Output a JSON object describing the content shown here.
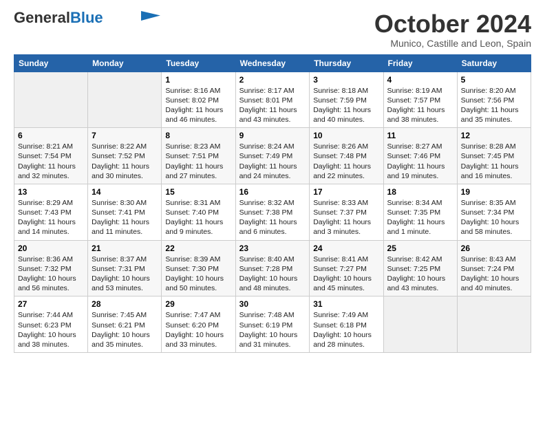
{
  "header": {
    "logo_general": "General",
    "logo_blue": "Blue",
    "month": "October 2024",
    "location": "Munico, Castille and Leon, Spain"
  },
  "days_of_week": [
    "Sunday",
    "Monday",
    "Tuesday",
    "Wednesday",
    "Thursday",
    "Friday",
    "Saturday"
  ],
  "weeks": [
    [
      {
        "day": "",
        "info": ""
      },
      {
        "day": "",
        "info": ""
      },
      {
        "day": "1",
        "info": "Sunrise: 8:16 AM\nSunset: 8:02 PM\nDaylight: 11 hours and 46 minutes."
      },
      {
        "day": "2",
        "info": "Sunrise: 8:17 AM\nSunset: 8:01 PM\nDaylight: 11 hours and 43 minutes."
      },
      {
        "day": "3",
        "info": "Sunrise: 8:18 AM\nSunset: 7:59 PM\nDaylight: 11 hours and 40 minutes."
      },
      {
        "day": "4",
        "info": "Sunrise: 8:19 AM\nSunset: 7:57 PM\nDaylight: 11 hours and 38 minutes."
      },
      {
        "day": "5",
        "info": "Sunrise: 8:20 AM\nSunset: 7:56 PM\nDaylight: 11 hours and 35 minutes."
      }
    ],
    [
      {
        "day": "6",
        "info": "Sunrise: 8:21 AM\nSunset: 7:54 PM\nDaylight: 11 hours and 32 minutes."
      },
      {
        "day": "7",
        "info": "Sunrise: 8:22 AM\nSunset: 7:52 PM\nDaylight: 11 hours and 30 minutes."
      },
      {
        "day": "8",
        "info": "Sunrise: 8:23 AM\nSunset: 7:51 PM\nDaylight: 11 hours and 27 minutes."
      },
      {
        "day": "9",
        "info": "Sunrise: 8:24 AM\nSunset: 7:49 PM\nDaylight: 11 hours and 24 minutes."
      },
      {
        "day": "10",
        "info": "Sunrise: 8:26 AM\nSunset: 7:48 PM\nDaylight: 11 hours and 22 minutes."
      },
      {
        "day": "11",
        "info": "Sunrise: 8:27 AM\nSunset: 7:46 PM\nDaylight: 11 hours and 19 minutes."
      },
      {
        "day": "12",
        "info": "Sunrise: 8:28 AM\nSunset: 7:45 PM\nDaylight: 11 hours and 16 minutes."
      }
    ],
    [
      {
        "day": "13",
        "info": "Sunrise: 8:29 AM\nSunset: 7:43 PM\nDaylight: 11 hours and 14 minutes."
      },
      {
        "day": "14",
        "info": "Sunrise: 8:30 AM\nSunset: 7:41 PM\nDaylight: 11 hours and 11 minutes."
      },
      {
        "day": "15",
        "info": "Sunrise: 8:31 AM\nSunset: 7:40 PM\nDaylight: 11 hours and 9 minutes."
      },
      {
        "day": "16",
        "info": "Sunrise: 8:32 AM\nSunset: 7:38 PM\nDaylight: 11 hours and 6 minutes."
      },
      {
        "day": "17",
        "info": "Sunrise: 8:33 AM\nSunset: 7:37 PM\nDaylight: 11 hours and 3 minutes."
      },
      {
        "day": "18",
        "info": "Sunrise: 8:34 AM\nSunset: 7:35 PM\nDaylight: 11 hours and 1 minute."
      },
      {
        "day": "19",
        "info": "Sunrise: 8:35 AM\nSunset: 7:34 PM\nDaylight: 10 hours and 58 minutes."
      }
    ],
    [
      {
        "day": "20",
        "info": "Sunrise: 8:36 AM\nSunset: 7:32 PM\nDaylight: 10 hours and 56 minutes."
      },
      {
        "day": "21",
        "info": "Sunrise: 8:37 AM\nSunset: 7:31 PM\nDaylight: 10 hours and 53 minutes."
      },
      {
        "day": "22",
        "info": "Sunrise: 8:39 AM\nSunset: 7:30 PM\nDaylight: 10 hours and 50 minutes."
      },
      {
        "day": "23",
        "info": "Sunrise: 8:40 AM\nSunset: 7:28 PM\nDaylight: 10 hours and 48 minutes."
      },
      {
        "day": "24",
        "info": "Sunrise: 8:41 AM\nSunset: 7:27 PM\nDaylight: 10 hours and 45 minutes."
      },
      {
        "day": "25",
        "info": "Sunrise: 8:42 AM\nSunset: 7:25 PM\nDaylight: 10 hours and 43 minutes."
      },
      {
        "day": "26",
        "info": "Sunrise: 8:43 AM\nSunset: 7:24 PM\nDaylight: 10 hours and 40 minutes."
      }
    ],
    [
      {
        "day": "27",
        "info": "Sunrise: 7:44 AM\nSunset: 6:23 PM\nDaylight: 10 hours and 38 minutes."
      },
      {
        "day": "28",
        "info": "Sunrise: 7:45 AM\nSunset: 6:21 PM\nDaylight: 10 hours and 35 minutes."
      },
      {
        "day": "29",
        "info": "Sunrise: 7:47 AM\nSunset: 6:20 PM\nDaylight: 10 hours and 33 minutes."
      },
      {
        "day": "30",
        "info": "Sunrise: 7:48 AM\nSunset: 6:19 PM\nDaylight: 10 hours and 31 minutes."
      },
      {
        "day": "31",
        "info": "Sunrise: 7:49 AM\nSunset: 6:18 PM\nDaylight: 10 hours and 28 minutes."
      },
      {
        "day": "",
        "info": ""
      },
      {
        "day": "",
        "info": ""
      }
    ]
  ]
}
